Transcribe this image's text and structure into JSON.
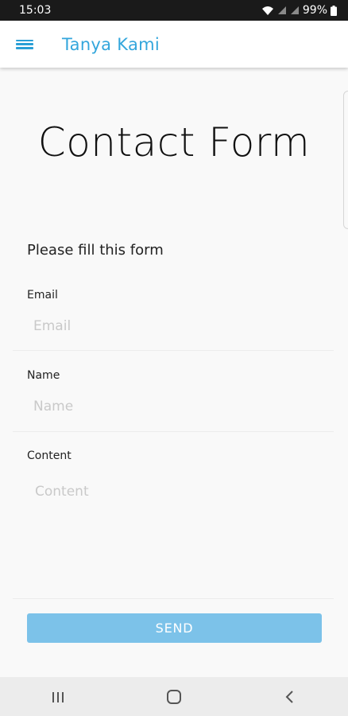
{
  "status_bar": {
    "time": "15:03",
    "battery": "99%"
  },
  "app_bar": {
    "title": "Tanya Kami",
    "menu_icon": "hamburger-menu-icon"
  },
  "page": {
    "title": "Contact Form",
    "form_heading": "Please fill this form"
  },
  "form": {
    "email": {
      "label": "Email",
      "placeholder": "Email"
    },
    "name": {
      "label": "Name",
      "placeholder": "Name"
    },
    "content": {
      "label": "Content",
      "placeholder": "Content"
    },
    "send_label": "SEND"
  },
  "nav_bar": {
    "items": [
      "recent-apps-icon",
      "home-icon",
      "back-icon"
    ]
  },
  "colors": {
    "accent": "#33a6dc",
    "button": "#7cc2e9"
  }
}
